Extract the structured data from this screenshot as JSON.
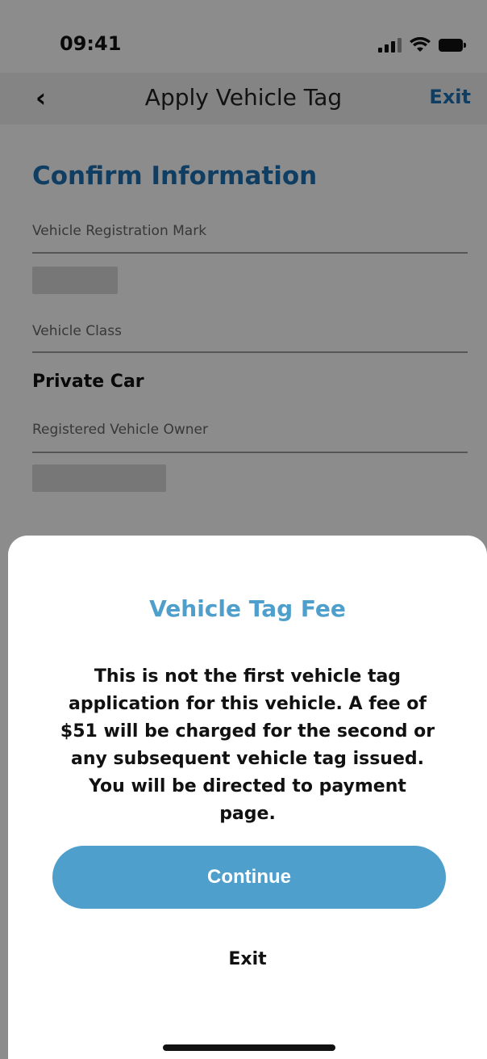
{
  "status_bar": {
    "time": "09:41"
  },
  "navbar": {
    "back_glyph": "‹",
    "title": "Apply Vehicle Tag",
    "exit_label": "Exit"
  },
  "form": {
    "section_title": "Confirm Information",
    "fields": [
      {
        "label": "Vehicle Registration Mark",
        "value": ""
      },
      {
        "label": "Vehicle Class",
        "value": "Private Car"
      },
      {
        "label": "Registered Vehicle Owner",
        "value": ""
      }
    ]
  },
  "dialog": {
    "title": "Vehicle Tag Fee",
    "message": "This is not the first vehicle tag application for this vehicle.  A fee of $51 will be charged for the second or any subsequent vehicle tag issued. You will be directed to payment page.",
    "continue_label": "Continue",
    "exit_label": "Exit"
  },
  "colors": {
    "accent": "#4f9fcc",
    "link": "#1e72b5",
    "overlay": "rgba(0,0,0,0.45)"
  },
  "icons": {
    "back": "chevron-left-icon",
    "signal": "cellular-signal-icon",
    "wifi": "wifi-icon",
    "battery": "battery-icon"
  }
}
